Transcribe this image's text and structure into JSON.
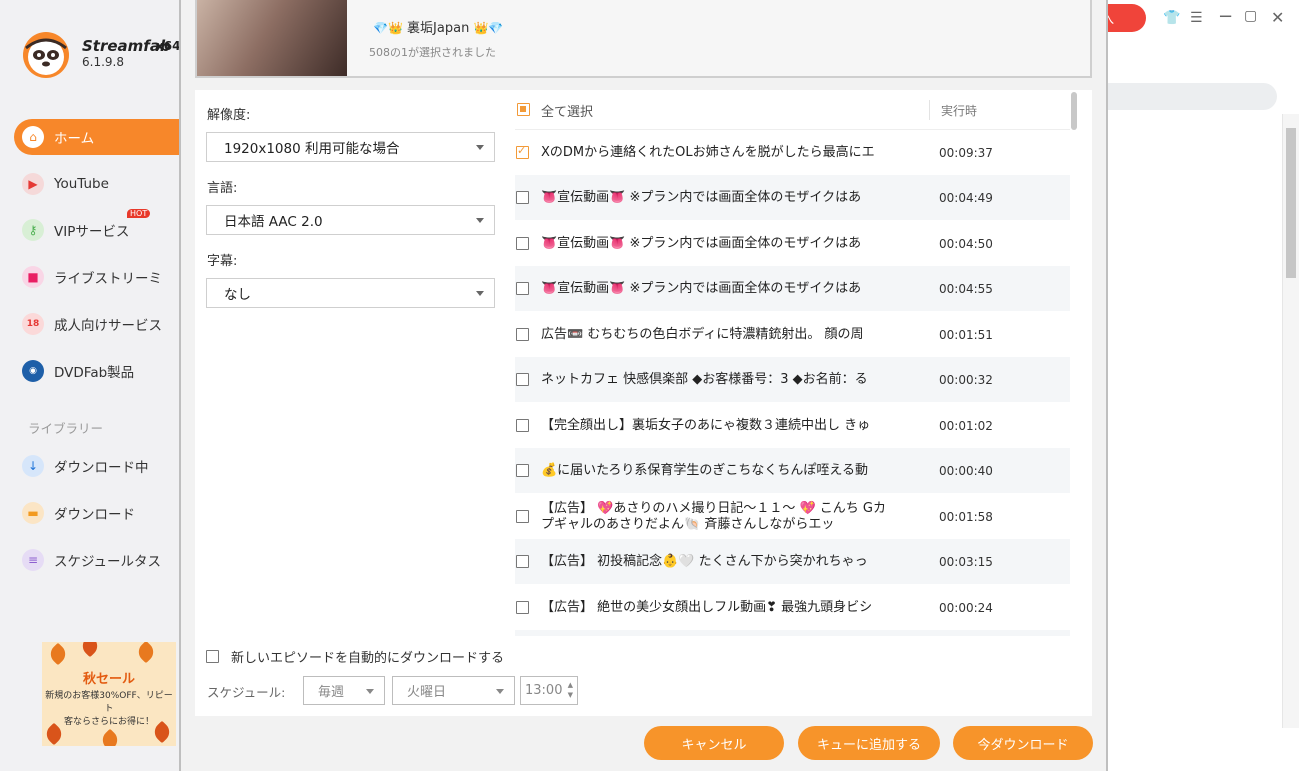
{
  "app": {
    "brand": "Streamfab",
    "arch": "x64",
    "version": "6.1.9.8"
  },
  "sidebar": {
    "items": [
      {
        "label": "ホーム",
        "icon": "home-icon",
        "active": true
      },
      {
        "label": "YouTube",
        "icon": "youtube-icon"
      },
      {
        "label": "VIPサービス",
        "icon": "key-icon",
        "badge": "HOT"
      },
      {
        "label": "ライブストリーミ",
        "icon": "camera-icon"
      },
      {
        "label": "成人向けサービス",
        "icon": "adult-18-icon"
      },
      {
        "label": "DVDFab製品",
        "icon": "dvdfab-icon"
      }
    ],
    "library_label": "ライブラリー",
    "library": [
      {
        "label": "ダウンロード中",
        "icon": "download-icon"
      },
      {
        "label": "ダウンロード",
        "icon": "folder-icon"
      },
      {
        "label": "スケジュールタス",
        "icon": "schedule-icon"
      }
    ],
    "promo": {
      "title": "秋セール",
      "line1": "新規のお客様30%OFF、リピート",
      "line2": "客ならさらにお得に！"
    }
  },
  "topbar": {
    "buy_label": "入"
  },
  "dialog": {
    "channel_title": "裏垢Japan",
    "channel_sub": "508の1が選択されました",
    "resolution_label": "解像度:",
    "resolution_value": "1920x1080 利用可能な場合",
    "language_label": "言語:",
    "language_value": "日本語 AAC 2.0",
    "subtitle_label": "字幕:",
    "subtitle_value": "なし",
    "select_all_label": "全て選択",
    "duration_header": "実行時",
    "episodes": [
      {
        "title": "XのDMから連絡くれたOLお姉さんを脱がしたら最高にエ",
        "duration": "00:09:37",
        "checked": true
      },
      {
        "title": "👅宣伝動画👅 ※プラン内では画面全体のモザイクはあ",
        "duration": "00:04:49",
        "checked": false
      },
      {
        "title": "👅宣伝動画👅 ※プラン内では画面全体のモザイクはあ",
        "duration": "00:04:50",
        "checked": false
      },
      {
        "title": "👅宣伝動画👅 ※プラン内では画面全体のモザイクはあ",
        "duration": "00:04:55",
        "checked": false
      },
      {
        "title": "広告📼 むちむちの色白ボディに特濃精銃射出。 顔の周",
        "duration": "00:01:51",
        "checked": false
      },
      {
        "title": "ネットカフェ 快感倶楽部 ◆お客様番号：3 ◆お名前：る",
        "duration": "00:00:32",
        "checked": false
      },
      {
        "title": "【完全顔出し】裏垢女子のあにゃ複数３連続中出し きゅ",
        "duration": "00:01:02",
        "checked": false
      },
      {
        "title": "💰に届いたろり系保育学生のぎこちなくちんぽ咥える動",
        "duration": "00:00:40",
        "checked": false
      },
      {
        "title": "【広告】 💖あさりのハメ撮り日記〜１１〜 💖 こんち Gカプギャルのあさりだよん🐚 斉藤さんしながらエッ",
        "duration": "00:01:58",
        "checked": false
      },
      {
        "title": "【広告】 初投稿記念👶🤍 たくさん下から突かれちゃっ",
        "duration": "00:03:15",
        "checked": false
      },
      {
        "title": "【広告】 絶世の美少女顔出しフル動画❣ 最強九頭身ビシ",
        "duration": "00:00:24",
        "checked": false
      }
    ],
    "auto_download_label": "新しいエピソードを自動的にダウンロードする",
    "schedule_label": "スケジュール:",
    "schedule_freq": "毎週",
    "schedule_day": "火曜日",
    "schedule_time": "13:00",
    "cancel_label": "キャンセル",
    "queue_label": "キューに追加する",
    "download_label": "今ダウンロード"
  }
}
